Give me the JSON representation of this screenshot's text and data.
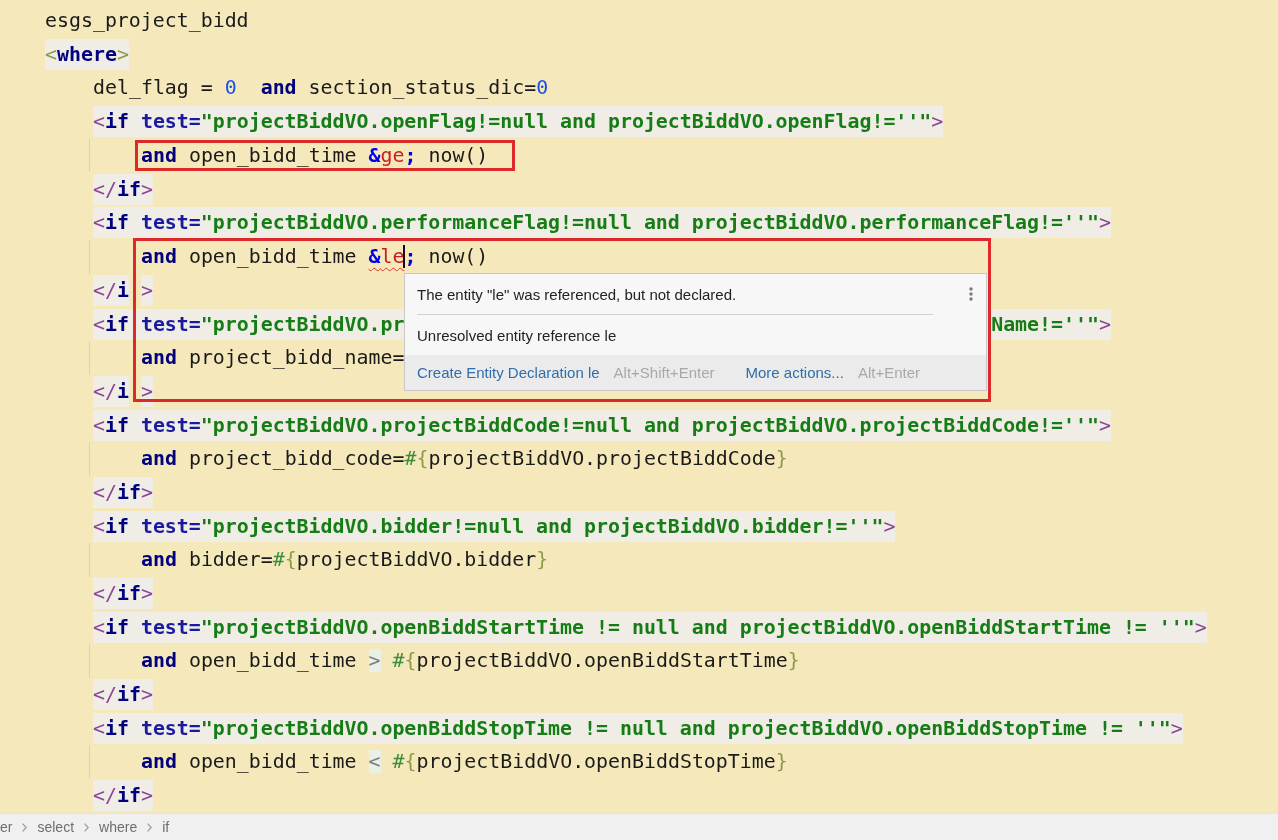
{
  "editor": {
    "lines": [
      {
        "kind": "code",
        "segments": [
          {
            "tokens": [
              {
                "text": "esgs_project_bidd",
                "kind": "text"
              }
            ]
          }
        ]
      },
      {
        "kind": "tag",
        "segments": [
          {
            "tokens": [
              {
                "text": "<",
                "kind": "soft"
              },
              {
                "text": "where",
                "kind": "tag"
              },
              {
                "text": ">",
                "kind": "soft"
              }
            ]
          }
        ],
        "children": [
          {
            "kind": "code",
            "segments": [
              {
                "tokens": [
                  {
                    "text": "del_flag = ",
                    "kind": "text"
                  },
                  {
                    "text": "0",
                    "kind": "number"
                  },
                  {
                    "text": "  and",
                    "kind": "keyword"
                  },
                  {
                    "text": " section_status_dic=",
                    "kind": "text"
                  },
                  {
                    "text": "0",
                    "kind": "number"
                  }
                ]
              }
            ]
          },
          {
            "kind": "tag",
            "segments": [
              {
                "tokens": [
                  {
                    "text": "<",
                    "kind": "punct"
                  },
                  {
                    "text": "if",
                    "kind": "tag"
                  },
                  {
                    "text": " test=",
                    "kind": "attr"
                  },
                  {
                    "text": "\"projectBiddVO.openFlag!=null and projectBiddVO.openFlag!=''\"",
                    "kind": "string"
                  },
                  {
                    "text": ">",
                    "kind": "punct"
                  }
                ]
              }
            ],
            "children": [
              {
                "kind": "code",
                "segments": [
                  {
                    "kind": "framed",
                    "tokens": [
                      {
                        "text": "and",
                        "kind": "keyword"
                      },
                      {
                        "text": " open_bidd_time ",
                        "kind": "text"
                      },
                      {
                        "text": "&",
                        "kind": "amp"
                      },
                      {
                        "text": "ge",
                        "kind": "entity"
                      },
                      {
                        "text": ";",
                        "kind": "amp"
                      },
                      {
                        "text": " now()",
                        "kind": "text"
                      }
                    ]
                  }
                ]
              }
            ]
          },
          {
            "kind": "tag",
            "segments": [
              {
                "tokens": [
                  {
                    "text": "</",
                    "kind": "punct"
                  },
                  {
                    "text": "if",
                    "kind": "tag"
                  },
                  {
                    "text": ">",
                    "kind": "punct"
                  }
                ]
              }
            ]
          },
          {
            "kind": "tag",
            "segments": [
              {
                "tokens": [
                  {
                    "text": "<",
                    "kind": "punct"
                  },
                  {
                    "text": "if",
                    "kind": "tag"
                  },
                  {
                    "text": " test=",
                    "kind": "attr"
                  },
                  {
                    "text": "\"projectBiddVO.performanceFlag!=null and projectBiddVO.performanceFlag!=''\"",
                    "kind": "string"
                  },
                  {
                    "text": ">",
                    "kind": "punct"
                  }
                ]
              }
            ],
            "children": [
              {
                "kind": "code",
                "segments": [
                  {
                    "tokens": [
                      {
                        "text": "and",
                        "kind": "keyword"
                      },
                      {
                        "text": " open_bidd_time ",
                        "kind": "text"
                      },
                      {
                        "text": "&",
                        "kind": "amp_error"
                      },
                      {
                        "text": "le",
                        "kind": "entity_error",
                        "caret": true
                      },
                      {
                        "text": ";",
                        "kind": "amp"
                      },
                      {
                        "text": " now()",
                        "kind": "text"
                      }
                    ]
                  }
                ]
              }
            ]
          },
          {
            "kind": "tag",
            "segments": [
              {
                "tokens": [
                  {
                    "text": "</",
                    "kind": "punct"
                  },
                  {
                    "text": "i",
                    "kind": "tag"
                  }
                ]
              },
              {
                "kind": "after_frame",
                "tokens": [
                  {
                    "text": ">",
                    "kind": "punct"
                  }
                ]
              }
            ]
          },
          {
            "kind": "tag",
            "segments": [
              {
                "tokens": [
                  {
                    "text": "<",
                    "kind": "punct"
                  },
                  {
                    "text": "if",
                    "kind": "tag"
                  },
                  {
                    "text": " test=",
                    "kind": "attr"
                  },
                  {
                    "text": "\"projectBiddVO.pr",
                    "kind": "string"
                  }
                ]
              },
              {
                "kind": "after_popup",
                "tokens": [
                  {
                    "text": "Name!=''\"",
                    "kind": "string"
                  },
                  {
                    "text": ">",
                    "kind": "punct"
                  }
                ]
              }
            ],
            "children": [
              {
                "kind": "code",
                "segments": [
                  {
                    "tokens": [
                      {
                        "text": "and",
                        "kind": "keyword"
                      },
                      {
                        "text": " project_bidd_name=",
                        "kind": "text"
                      }
                    ]
                  }
                ]
              }
            ]
          },
          {
            "kind": "tag",
            "segments": [
              {
                "tokens": [
                  {
                    "text": "</",
                    "kind": "punct"
                  },
                  {
                    "text": "i",
                    "kind": "tag"
                  }
                ]
              },
              {
                "kind": "after_frame",
                "tokens": [
                  {
                    "text": ">",
                    "kind": "punct"
                  }
                ]
              }
            ]
          },
          {
            "kind": "tag",
            "segments": [
              {
                "tokens": [
                  {
                    "text": "<",
                    "kind": "punct"
                  },
                  {
                    "text": "if",
                    "kind": "tag"
                  },
                  {
                    "text": " test=",
                    "kind": "attr"
                  },
                  {
                    "text": "\"projectBiddVO.projectBiddCode!=null and projectBiddVO.projectBiddCode!=''\"",
                    "kind": "string"
                  },
                  {
                    "text": ">",
                    "kind": "punct"
                  }
                ]
              }
            ],
            "children": [
              {
                "kind": "code",
                "segments": [
                  {
                    "tokens": [
                      {
                        "text": "and",
                        "kind": "keyword"
                      },
                      {
                        "text": " project_bidd_code=",
                        "kind": "text"
                      },
                      {
                        "text": "#",
                        "kind": "expr"
                      },
                      {
                        "text": "{",
                        "kind": "soft"
                      },
                      {
                        "text": "projectBiddVO.projectBiddCode",
                        "kind": "text"
                      },
                      {
                        "text": "}",
                        "kind": "soft"
                      }
                    ]
                  }
                ]
              }
            ]
          },
          {
            "kind": "tag",
            "segments": [
              {
                "tokens": [
                  {
                    "text": "</",
                    "kind": "punct"
                  },
                  {
                    "text": "if",
                    "kind": "tag"
                  },
                  {
                    "text": ">",
                    "kind": "punct"
                  }
                ]
              }
            ]
          },
          {
            "kind": "tag",
            "segments": [
              {
                "tokens": [
                  {
                    "text": "<",
                    "kind": "punct"
                  },
                  {
                    "text": "if",
                    "kind": "tag"
                  },
                  {
                    "text": " test=",
                    "kind": "attr"
                  },
                  {
                    "text": "\"projectBiddVO.bidder!=null and projectBiddVO.bidder!=''\"",
                    "kind": "string"
                  },
                  {
                    "text": ">",
                    "kind": "punct"
                  }
                ]
              }
            ],
            "children": [
              {
                "kind": "code",
                "segments": [
                  {
                    "tokens": [
                      {
                        "text": "and",
                        "kind": "keyword"
                      },
                      {
                        "text": " bidder=",
                        "kind": "text"
                      },
                      {
                        "text": "#",
                        "kind": "expr"
                      },
                      {
                        "text": "{",
                        "kind": "soft"
                      },
                      {
                        "text": "projectBiddVO.bidder",
                        "kind": "text"
                      },
                      {
                        "text": "}",
                        "kind": "soft"
                      }
                    ]
                  }
                ]
              }
            ]
          },
          {
            "kind": "tag",
            "segments": [
              {
                "tokens": [
                  {
                    "text": "</",
                    "kind": "punct"
                  },
                  {
                    "text": "if",
                    "kind": "tag"
                  },
                  {
                    "text": ">",
                    "kind": "punct"
                  }
                ]
              }
            ]
          },
          {
            "kind": "tag",
            "segments": [
              {
                "tokens": [
                  {
                    "text": "<",
                    "kind": "punct"
                  },
                  {
                    "text": "if",
                    "kind": "tag"
                  },
                  {
                    "text": " test=",
                    "kind": "attr"
                  },
                  {
                    "text": "\"projectBiddVO.openBiddStartTime != null and projectBiddVO.openBiddStartTime != ''\"",
                    "kind": "string"
                  },
                  {
                    "text": ">",
                    "kind": "punct"
                  }
                ]
              }
            ],
            "children": [
              {
                "kind": "code",
                "segments": [
                  {
                    "tokens": [
                      {
                        "text": "and",
                        "kind": "keyword"
                      },
                      {
                        "text": " open_bidd_time ",
                        "kind": "text"
                      },
                      {
                        "text": ">",
                        "kind": "folded"
                      },
                      {
                        "text": " #",
                        "kind": "expr"
                      },
                      {
                        "text": "{",
                        "kind": "soft"
                      },
                      {
                        "text": "projectBiddVO.openBiddStartTime",
                        "kind": "text"
                      },
                      {
                        "text": "}",
                        "kind": "soft"
                      }
                    ]
                  }
                ]
              }
            ]
          },
          {
            "kind": "tag",
            "segments": [
              {
                "tokens": [
                  {
                    "text": "</",
                    "kind": "punct"
                  },
                  {
                    "text": "if",
                    "kind": "tag"
                  },
                  {
                    "text": ">",
                    "kind": "punct"
                  }
                ]
              }
            ]
          },
          {
            "kind": "tag",
            "segments": [
              {
                "tokens": [
                  {
                    "text": "<",
                    "kind": "punct"
                  },
                  {
                    "text": "if",
                    "kind": "tag"
                  },
                  {
                    "text": " test=",
                    "kind": "attr"
                  },
                  {
                    "text": "\"projectBiddVO.openBiddStopTime != null and projectBiddVO.openBiddStopTime != ''\"",
                    "kind": "string"
                  },
                  {
                    "text": ">",
                    "kind": "punct"
                  }
                ]
              }
            ],
            "children": [
              {
                "kind": "code",
                "segments": [
                  {
                    "tokens": [
                      {
                        "text": "and",
                        "kind": "keyword"
                      },
                      {
                        "text": " open_bidd_time ",
                        "kind": "text"
                      },
                      {
                        "text": "<",
                        "kind": "folded"
                      },
                      {
                        "text": " #",
                        "kind": "expr"
                      },
                      {
                        "text": "{",
                        "kind": "soft"
                      },
                      {
                        "text": "projectBiddVO.openBiddStopTime",
                        "kind": "text"
                      },
                      {
                        "text": "}",
                        "kind": "soft"
                      }
                    ]
                  }
                ]
              }
            ]
          },
          {
            "kind": "tag",
            "segments": [
              {
                "tokens": [
                  {
                    "text": "</",
                    "kind": "punct"
                  },
                  {
                    "text": "if",
                    "kind": "tag"
                  },
                  {
                    "text": ">",
                    "kind": "punct"
                  }
                ]
              }
            ]
          }
        ]
      }
    ]
  },
  "frames": [
    {
      "kind": "frame"
    }
  ],
  "popup": {
    "messages": [
      "The entity \"le\" was referenced, but not declared.",
      "Unresolved entity reference le"
    ],
    "actions": [
      {
        "label": "Create Entity Declaration le",
        "shortcut": "Alt+Shift+Enter"
      },
      {
        "label": "More actions...",
        "shortcut": "Alt+Enter"
      }
    ]
  },
  "breadcrumbs": [
    "er",
    "select",
    "where",
    "if"
  ]
}
